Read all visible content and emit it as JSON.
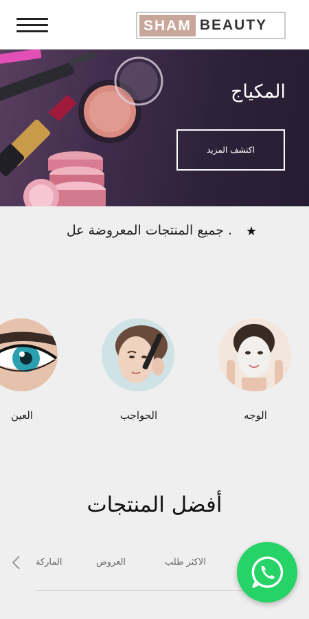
{
  "header": {
    "logo_part1": "SHAM",
    "logo_part2": "BEAUTY"
  },
  "hero": {
    "title": "المكياج",
    "button_label": "اكتشف المزيد"
  },
  "notice": {
    "text": ". جميع المنتجات المعروضة عل"
  },
  "categories": [
    {
      "label": "الوجه"
    },
    {
      "label": "الحواجب"
    },
    {
      "label": "العين"
    }
  ],
  "best_products": {
    "title": "أفضل المنتجات",
    "tabs": [
      {
        "label": "الاكثر طلب"
      },
      {
        "label": "العروض"
      },
      {
        "label": "الماركة"
      }
    ]
  },
  "colors": {
    "accent": "#c8a79a",
    "whatsapp": "#25d366",
    "hero_bg": "#3f2c4c"
  }
}
